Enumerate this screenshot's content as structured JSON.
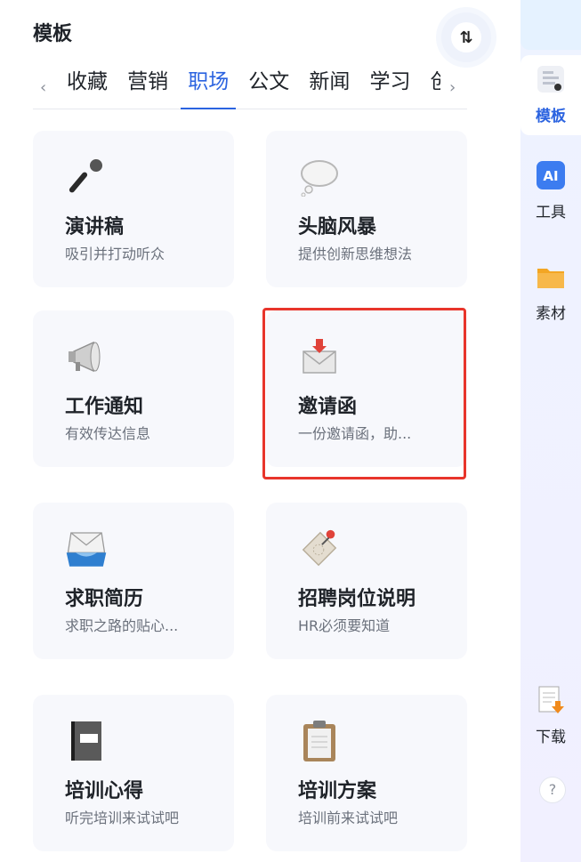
{
  "panel": {
    "title": "模板",
    "sort_icon_text": "⇅"
  },
  "tabs": {
    "items": [
      "收藏",
      "营销",
      "职场",
      "公文",
      "新闻",
      "学习",
      "创"
    ],
    "active_index": 2,
    "prev_arrow": "‹",
    "next_arrow": "›"
  },
  "cards": [
    {
      "name": "演讲稿",
      "desc": "吸引并打动听众",
      "icon": "microphone-icon"
    },
    {
      "name": "头脑风暴",
      "desc": "提供创新思维想法",
      "icon": "thought-cloud-icon"
    },
    {
      "name": "工作通知",
      "desc": "有效传达信息",
      "icon": "megaphone-icon"
    },
    {
      "name": "邀请函",
      "desc": "一份邀请函，助...",
      "icon": "envelope-arrow-icon"
    },
    {
      "name": "求职简历",
      "desc": "求职之路的贴心...",
      "icon": "mail-tray-icon"
    },
    {
      "name": "招聘岗位说明",
      "desc": "HR必须要知道",
      "icon": "tag-pin-icon"
    },
    {
      "name": "培训心得",
      "desc": "听完培训来试试吧",
      "icon": "notebook-icon"
    },
    {
      "name": "培训方案",
      "desc": "培训前来试试吧",
      "icon": "clipboard-icon"
    }
  ],
  "sidebar": {
    "items": [
      {
        "label": "模板",
        "icon": "template-icon",
        "active": true
      },
      {
        "label": "工具",
        "icon": "ai-tool-icon",
        "badge": "AI"
      },
      {
        "label": "素材",
        "icon": "folder-icon"
      },
      {
        "label": "下载",
        "icon": "download-doc-icon"
      }
    ],
    "help": "?"
  },
  "colors": {
    "accent": "#2b63e0",
    "highlight": "#e8352b",
    "card_bg": "#f7f8fc"
  }
}
